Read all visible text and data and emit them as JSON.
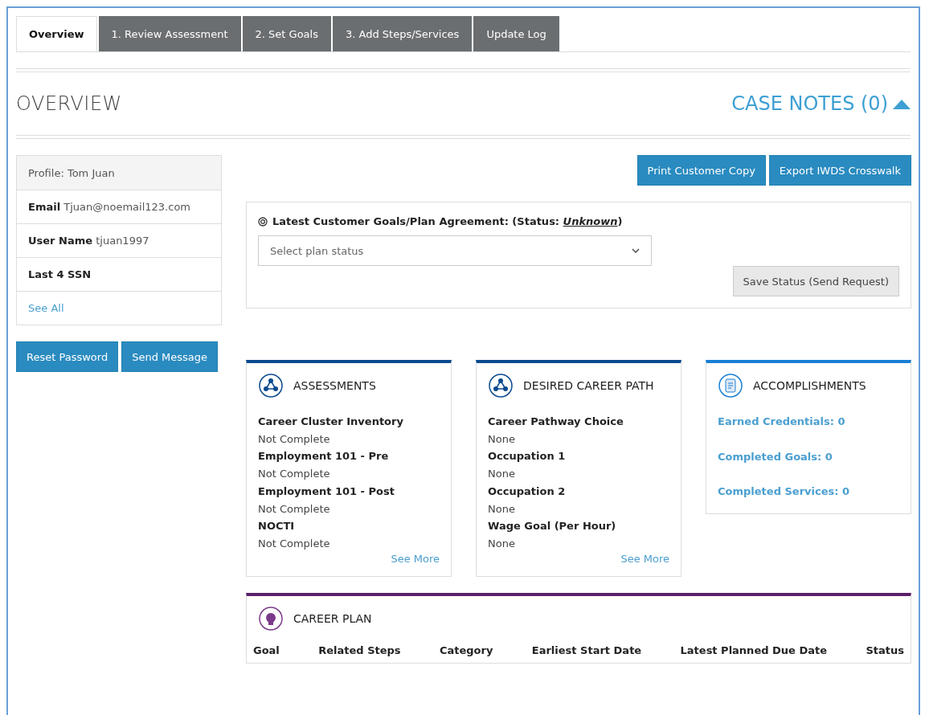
{
  "tabs": [
    {
      "label": "Overview",
      "selected": true
    },
    {
      "label": "1. Review Assessment",
      "selected": false
    },
    {
      "label": "2. Set Goals",
      "selected": false
    },
    {
      "label": "3. Add Steps/Services",
      "selected": false
    },
    {
      "label": "Update Log",
      "selected": false
    }
  ],
  "heading": "OVERVIEW",
  "case_notes": {
    "label": "CASE NOTES (0)",
    "expanded": true
  },
  "profile": {
    "title": "Profile: Tom Juan",
    "fields": [
      {
        "label": "Email",
        "value": "Tjuan@noemail123.com"
      },
      {
        "label": "User Name",
        "value": "tjuan1997"
      },
      {
        "label": "Last 4 SSN"
      }
    ],
    "link": "See All"
  },
  "profile_buttons": [
    "Reset Password",
    "Send Message"
  ],
  "top_buttons": [
    "Print Customer Copy",
    "Export IWDS Crosswalk"
  ],
  "agreement": {
    "title": "Latest Customer Goals/Plan Agreement: (Status: *Unknown*)",
    "select_placeholder": "Select plan status",
    "button": "Save Status (Send Request)"
  },
  "cards": [
    {
      "kind": "list",
      "title": "ASSESSMENTS",
      "color": "#0b4a8f",
      "items": [
        {
          "label": "Career Cluster Inventory",
          "value": "Not Complete"
        },
        {
          "label": "Employment 101 - Pre",
          "value": "Not Complete"
        },
        {
          "label": "Employment 101 - Post",
          "value": "Not Complete"
        },
        {
          "label": "NOCTI",
          "value": "Not Complete"
        }
      ],
      "link": "See More"
    },
    {
      "kind": "list",
      "title": "DESIRED CAREER PATH",
      "color": "#0b4a8f",
      "items": [
        {
          "label": "Career Pathway Choice",
          "value": "None"
        },
        {
          "label": "Occupation 1",
          "value": "None"
        },
        {
          "label": "Occupation 2",
          "value": "None"
        },
        {
          "label": "Wage Goal (Per Hour)",
          "value": "None"
        }
      ],
      "link": "See More"
    },
    {
      "kind": "links",
      "title": "ACCOMPLISHMENTS",
      "color": "#1a7fd4",
      "links": [
        "Earned Credentials: 0",
        "Completed Goals: 0",
        "Completed Services: 0"
      ]
    }
  ],
  "career_plan": {
    "title": "CAREER PLAN",
    "columns": [
      "Goal",
      "Related Steps",
      "Category",
      "Earliest Start Date",
      "Latest Planned Due Date",
      "Status"
    ]
  }
}
